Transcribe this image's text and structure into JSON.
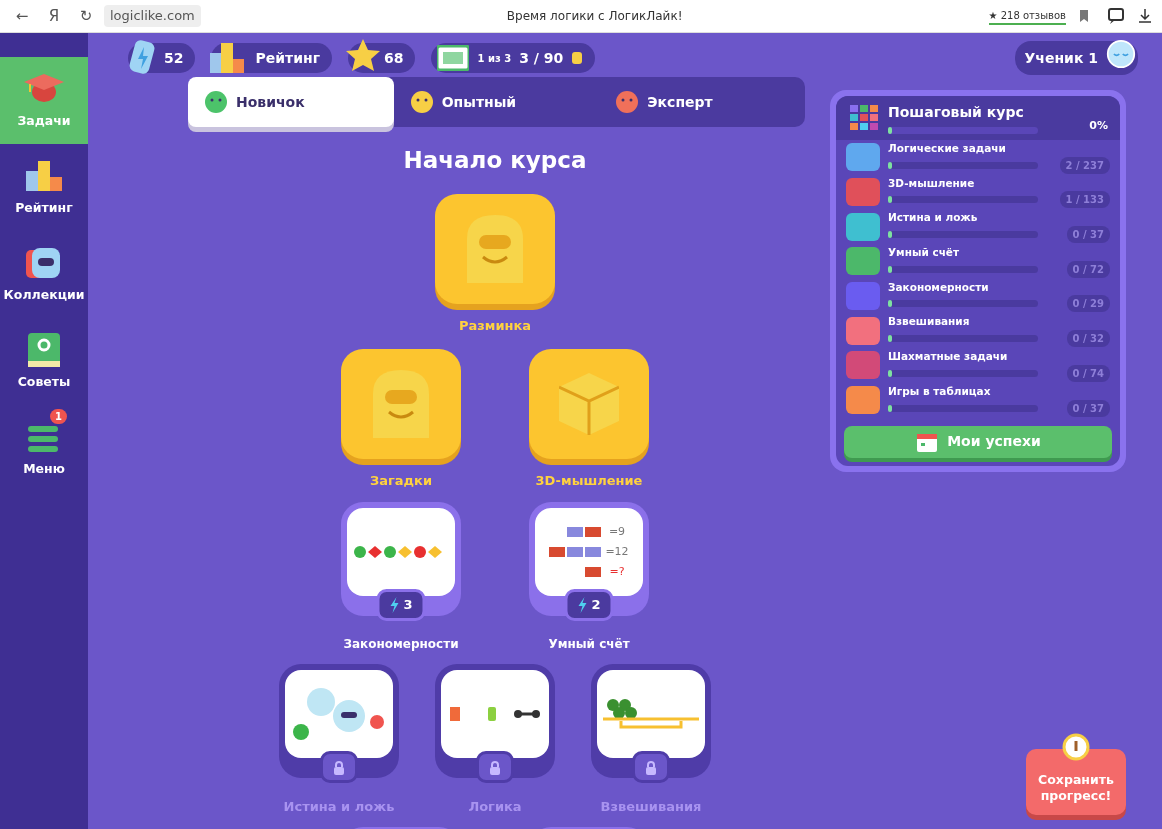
{
  "browser": {
    "back": "←",
    "yandex": "Я",
    "reload": "↻",
    "url": "logiclike.com",
    "title": "Время логики с ЛогикЛайк!",
    "reviews": "★ 218 отзывов"
  },
  "sidebar": {
    "items": [
      {
        "kind": "courses",
        "label": "Задачи",
        "selected": true
      },
      {
        "kind": "rating",
        "label": "Рейтинг",
        "selected": false
      },
      {
        "kind": "collections",
        "label": "Коллекции",
        "selected": false
      },
      {
        "kind": "tips",
        "label": "Советы",
        "selected": false
      },
      {
        "kind": "menu",
        "label": "Меню",
        "selected": false,
        "badge": "1"
      }
    ]
  },
  "stats": {
    "energy": "52",
    "rating": "Рейтинг",
    "stars": "68",
    "tickets_note": "1 из 3",
    "tickets": "3 / 90"
  },
  "user": {
    "name": "Ученик 1"
  },
  "levels": [
    {
      "kind": "green",
      "label": "Новичок",
      "selected": true
    },
    {
      "kind": "yellow",
      "label": "Опытный",
      "selected": false
    },
    {
      "kind": "red",
      "label": "Эксперт",
      "selected": false
    }
  ],
  "course_title": "Начало курса",
  "map": [
    [
      {
        "kind": "featured",
        "label": "Разминка"
      }
    ],
    [
      {
        "kind": "featured",
        "label": "Загадки"
      },
      {
        "kind": "featured",
        "label": "3D-мышление"
      }
    ],
    [
      {
        "kind": "card",
        "label": "Закономерности",
        "locked": false,
        "energy": "3"
      },
      {
        "kind": "card",
        "label": "Умный счёт",
        "locked": false,
        "energy": "2",
        "equations": [
          "=9",
          "=12",
          "=?"
        ]
      }
    ],
    [
      {
        "kind": "card",
        "label": "Истина и ложь",
        "locked": true
      },
      {
        "kind": "card",
        "label": "Логика",
        "locked": true
      },
      {
        "kind": "card",
        "label": "Взвешивания",
        "locked": true
      }
    ],
    [
      {
        "kind": "card"
      },
      {
        "kind": "card"
      }
    ]
  ],
  "course_panel": {
    "title": "Пошаговый курс",
    "percent": "0%",
    "level": 0,
    "items": [
      {
        "label": "Логические задачи",
        "count": "2 / 237",
        "level": 0.01,
        "color": "#5fa8ee"
      },
      {
        "label": "3D-мышление",
        "count": "1 / 133",
        "level": 0.01,
        "color": "#e0505a"
      },
      {
        "label": "Истина и ложь",
        "count": "0 / 37",
        "level": 0,
        "color": "#3fbfd0"
      },
      {
        "label": "Умный счёт",
        "count": "0 / 72",
        "level": 0,
        "color": "#4cb86a"
      },
      {
        "label": "Закономерности",
        "count": "0 / 29",
        "level": 0,
        "color": "#6a5cf0"
      },
      {
        "label": "Взвешивания",
        "count": "0 / 32",
        "level": 0,
        "color": "#f2707e"
      },
      {
        "label": "Шахматные задачи",
        "count": "0 / 74",
        "level": 0,
        "color": "#d24a78"
      },
      {
        "label": "Игры в таблицах",
        "count": "0 / 37",
        "level": 0,
        "color": "#f58a4a"
      }
    ],
    "button": "Мои успехи"
  },
  "save_button": "Сохранить прогресс!"
}
